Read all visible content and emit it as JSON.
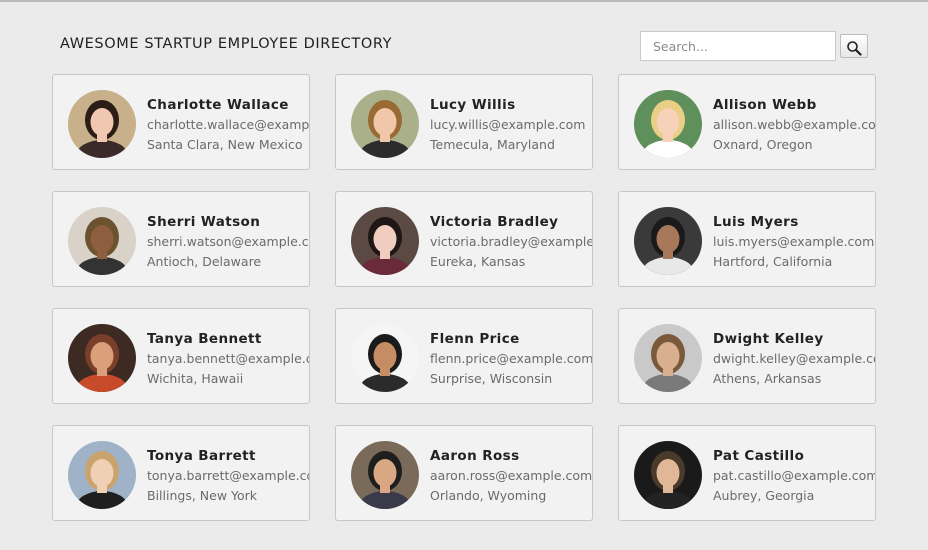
{
  "header": {
    "title": "AWESOME STARTUP EMPLOYEE DIRECTORY"
  },
  "search": {
    "placeholder": "Search...",
    "button_icon": "magnifier-icon"
  },
  "employees": [
    {
      "name": "Charlotte Wallace",
      "email": "charlotte.wallace@example.com",
      "location": "Santa Clara, New Mexico",
      "bg": "#c7b08a",
      "hair": "#2b1d16",
      "skin": "#f0c7b0",
      "shirt": "#3a2a2a"
    },
    {
      "name": "Lucy Willis",
      "email": "lucy.willis@example.com",
      "location": "Temecula, Maryland",
      "bg": "#a9b08a",
      "hair": "#9a6a35",
      "skin": "#f0c7a8",
      "shirt": "#2c2c2c"
    },
    {
      "name": "Allison Webb",
      "email": "allison.webb@example.com",
      "location": "Oxnard, Oregon",
      "bg": "#5f8f5a",
      "hair": "#e8cf85",
      "skin": "#f5d2b8",
      "shirt": "#ffffff"
    },
    {
      "name": "Sherri Watson",
      "email": "sherri.watson@example.com",
      "location": "Antioch, Delaware",
      "bg": "#d9d2c8",
      "hair": "#6b5330",
      "skin": "#8d5e3f",
      "shirt": "#333333"
    },
    {
      "name": "Victoria Bradley",
      "email": "victoria.bradley@example.com",
      "location": "Eureka, Kansas",
      "bg": "#5b4a44",
      "hair": "#1e1715",
      "skin": "#f0cdbf",
      "shirt": "#6b2a3a"
    },
    {
      "name": "Luis Myers",
      "email": "luis.myers@example.com",
      "location": "Hartford, California",
      "bg": "#3a3a3a",
      "hair": "#1a1a1a",
      "skin": "#a8785a",
      "shirt": "#e8e8e8"
    },
    {
      "name": "Tanya Bennett",
      "email": "tanya.bennett@example.com",
      "location": "Wichita, Hawaii",
      "bg": "#3d2a22",
      "hair": "#7a3f2a",
      "skin": "#d9a07a",
      "shirt": "#c74a2a"
    },
    {
      "name": "Flenn Price",
      "email": "flenn.price@example.com",
      "location": "Surprise, Wisconsin",
      "bg": "#f5f5f5",
      "hair": "#1b1b1b",
      "skin": "#c68c63",
      "shirt": "#2b2b2b"
    },
    {
      "name": "Dwight Kelley",
      "email": "dwight.kelley@example.com",
      "location": "Athens, Arkansas",
      "bg": "#c9c9c9",
      "hair": "#7a5a3a",
      "skin": "#d9b08f",
      "shirt": "#7a7a7a"
    },
    {
      "name": "Tonya Barrett",
      "email": "tonya.barrett@example.com",
      "location": "Billings, New York",
      "bg": "#9fb2c8",
      "hair": "#c9a36b",
      "skin": "#f0d0b5",
      "shirt": "#1f1f1f"
    },
    {
      "name": "Aaron Ross",
      "email": "aaron.ross@example.com",
      "location": "Orlando, Wyoming",
      "bg": "#7a6a5a",
      "hair": "#1e1e1e",
      "skin": "#d9a882",
      "shirt": "#3a3a4a"
    },
    {
      "name": "Pat Castillo",
      "email": "pat.castillo@example.com",
      "location": "Aubrey, Georgia",
      "bg": "#1a1a1a",
      "hair": "#4a3a2a",
      "skin": "#e0b898",
      "shirt": "#222222"
    }
  ]
}
